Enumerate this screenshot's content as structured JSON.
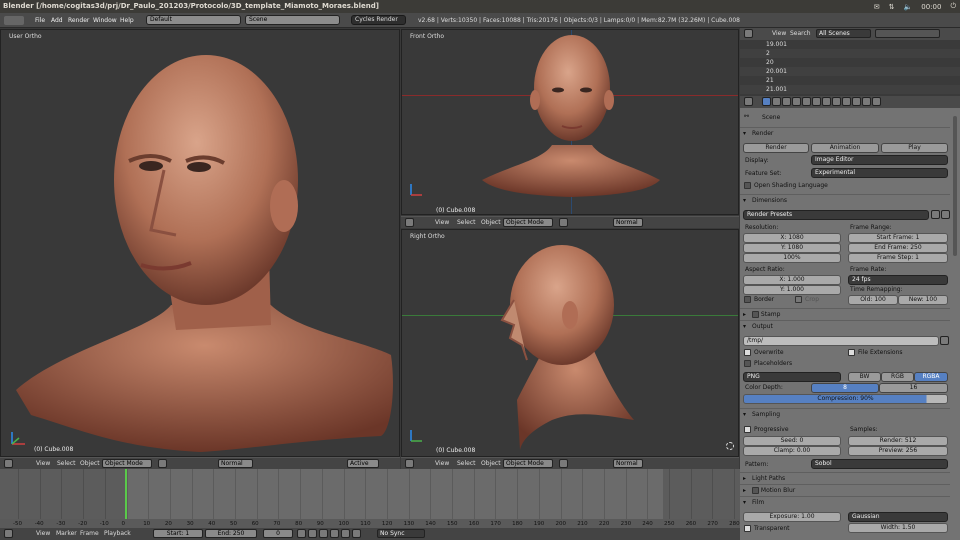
{
  "window_title": "Blender [/home/cogitas3d/prj/Dr_Paulo_201203/Protocolo/3D_template_Miamoto_Moraes.blend]",
  "tray": {
    "mail": "✉",
    "network": "⇅",
    "sound": "🔈",
    "clock": "00:00",
    "power": "⏻"
  },
  "top_menu": [
    "File",
    "Add",
    "Render",
    "Window",
    "Help"
  ],
  "screen_layout": "Default",
  "scene_name": "Scene",
  "engine": "Cycles Render",
  "stats": "v2.68 | Verts:10350 | Faces:10088 | Tris:20176 | Objects:0/3 | Lamps:0/0 | Mem:82.7M (32.26M) | Cube.008",
  "viewports": {
    "user": {
      "label": "User Ortho",
      "object": "(0) Cube.008"
    },
    "front": {
      "label": "Front Ortho",
      "object": "(0) Cube.008"
    },
    "right": {
      "label": "Right Ortho",
      "object": "(0) Cube.008"
    }
  },
  "view_header": {
    "view": "View",
    "select": "Select",
    "object": "Object",
    "mode": "Object Mode",
    "shading": "Normal",
    "pivot": "Active"
  },
  "timeline": {
    "ticks": [
      "-50",
      "-40",
      "-30",
      "-20",
      "-10",
      "0",
      "10",
      "20",
      "30",
      "40",
      "50",
      "60",
      "70",
      "80",
      "90",
      "100",
      "110",
      "120",
      "130",
      "140",
      "150",
      "160",
      "170",
      "180",
      "190",
      "200",
      "210",
      "220",
      "230",
      "240",
      "250",
      "260",
      "270",
      "280"
    ],
    "view": "View",
    "marker": "Marker",
    "frame": "Frame",
    "playback": "Playback",
    "start": "Start: 1",
    "end": "End: 250",
    "current": "0",
    "sync": "No Sync"
  },
  "outliner": {
    "view": "View",
    "search": "Search",
    "filter": "All Scenes",
    "rows": [
      "19.001",
      "2",
      "20",
      "20.001",
      "21",
      "21.001"
    ]
  },
  "properties": {
    "scene": "Scene",
    "render": {
      "title": "Render",
      "btn_render": "Render",
      "btn_anim": "Animation",
      "btn_play": "Play",
      "display_label": "Display:",
      "display_value": "Image Editor",
      "feature_label": "Feature Set:",
      "feature_value": "Experimental",
      "osl": "Open Shading Language"
    },
    "dimensions": {
      "title": "Dimensions",
      "presets": "Render Presets",
      "resolution": "Resolution:",
      "res_x": "X: 1080",
      "res_y": "Y: 1080",
      "res_pct": "100%",
      "frame_range": "Frame Range:",
      "start": "Start Frame: 1",
      "end": "End Frame: 250",
      "step": "Frame Step: 1",
      "aspect": "Aspect Ratio:",
      "asp_x": "X: 1.000",
      "asp_y": "Y: 1.000",
      "frame_rate": "Frame Rate:",
      "fps": "24 fps",
      "time_remap": "Time Remapping:",
      "old": "Old: 100",
      "new": "New: 100",
      "border": "Border",
      "crop": "Crop"
    },
    "stamp": "Stamp",
    "output": {
      "title": "Output",
      "path": "/tmp/",
      "overwrite": "Overwrite",
      "file_ext": "File Extensions",
      "placeholders": "Placeholders",
      "format": "PNG",
      "bw": "BW",
      "rgb": "RGB",
      "rgba": "RGBA",
      "depth_label": "Color Depth:",
      "d8": "8",
      "d16": "16",
      "compression": "Compression: 90%"
    },
    "sampling": {
      "title": "Sampling",
      "progressive": "Progressive",
      "samples": "Samples:",
      "seed": "Seed: 0",
      "clamp": "Clamp: 0.00",
      "render": "Render: 512",
      "preview": "Preview: 256",
      "pattern_label": "Pattern:",
      "pattern": "Sobol"
    },
    "light_paths": "Light Paths",
    "motion_blur": "Motion Blur",
    "film": {
      "title": "Film",
      "exposure": "Exposure: 1.00",
      "filter": "Gaussian",
      "transparent": "Transparent",
      "width": "Width: 1.50"
    }
  }
}
